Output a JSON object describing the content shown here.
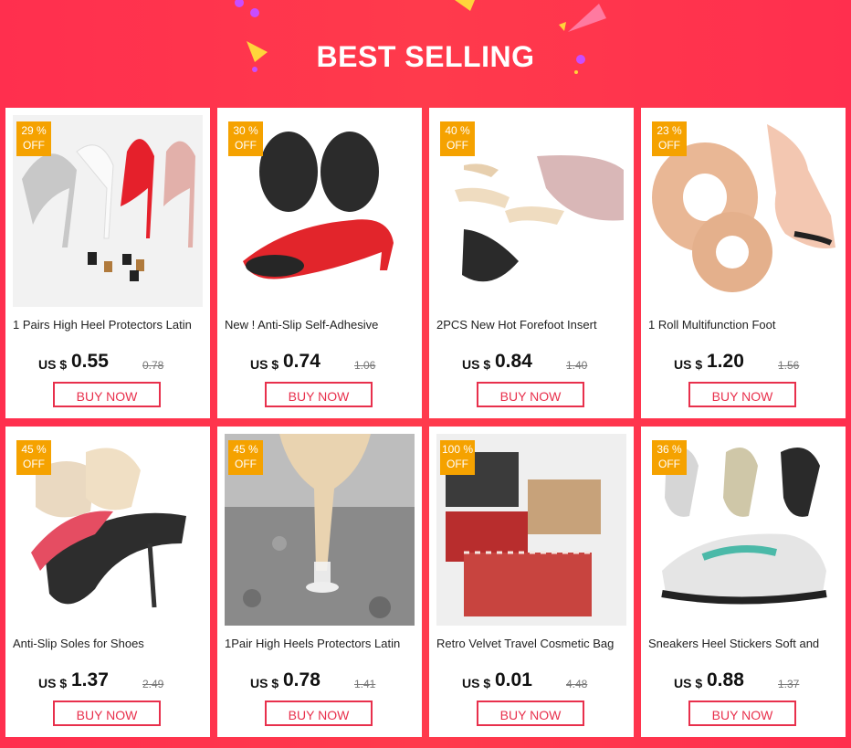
{
  "header": {
    "title": "BEST SELLING"
  },
  "products": [
    {
      "badge_pct": "29 %",
      "badge_off": "OFF",
      "name": "1 Pairs High Heel Protectors Latin",
      "currency": "US $",
      "price": "0.55",
      "old_price": "0.78",
      "cta": "BUY NOW",
      "image_icon": "heels-protectors-image"
    },
    {
      "badge_pct": "30 %",
      "badge_off": "OFF",
      "name": "New ! Anti-Slip Self-Adhesive",
      "currency": "US $",
      "price": "0.74",
      "old_price": "1.06",
      "cta": "BUY NOW",
      "image_icon": "anti-slip-pad-image"
    },
    {
      "badge_pct": "40 %",
      "badge_off": "OFF",
      "name": "2PCS New Hot  Forefoot Insert",
      "currency": "US $",
      "price": "0.84",
      "old_price": "1.40",
      "cta": "BUY NOW",
      "image_icon": "forefoot-insert-image"
    },
    {
      "badge_pct": "23 %",
      "badge_off": "OFF",
      "name": "1 Roll Multifunction Foot",
      "currency": "US $",
      "price": "1.20",
      "old_price": "1.56",
      "cta": "BUY NOW",
      "image_icon": "foot-tape-roll-image"
    },
    {
      "badge_pct": "45 %",
      "badge_off": "OFF",
      "name": "Anti-Slip Soles for Shoes",
      "currency": "US $",
      "price": "1.37",
      "old_price": "2.49",
      "cta": "BUY NOW",
      "image_icon": "anti-slip-soles-image"
    },
    {
      "badge_pct": "45 %",
      "badge_off": "OFF",
      "name": "1Pair High Heels Protectors Latin",
      "currency": "US $",
      "price": "0.78",
      "old_price": "1.41",
      "cta": "BUY NOW",
      "image_icon": "heel-protector-gravel-image"
    },
    {
      "badge_pct": "100 %",
      "badge_off": "OFF",
      "name": "Retro Velvet Travel Cosmetic Bag",
      "currency": "US $",
      "price": "0.01",
      "old_price": "4.48",
      "cta": "BUY NOW",
      "image_icon": "cosmetic-bag-image"
    },
    {
      "badge_pct": "36 %",
      "badge_off": "OFF",
      "name": "Sneakers Heel Stickers Soft and",
      "currency": "US $",
      "price": "0.88",
      "old_price": "1.37",
      "cta": "BUY NOW",
      "image_icon": "sneaker-heel-sticker-image"
    }
  ]
}
